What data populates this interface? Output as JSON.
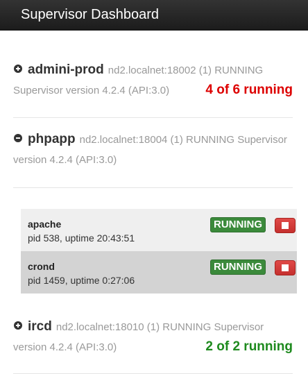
{
  "navbar": {
    "title": "Supervisor Dashboard"
  },
  "servers": [
    {
      "name": "admini-prod",
      "info": "nd2.localnet:18002 (1) RUNNING",
      "version": "Supervisor version 4.2.4 (API:3.0)",
      "count": "4 of 6 running",
      "count_color": "#dd0000",
      "expanded": false
    },
    {
      "name": "phpapp",
      "info": "nd2.localnet:18004 (1) RUNNING Supervisor",
      "version": "version 4.2.4 (API:3.0)",
      "expanded": true,
      "processes": [
        {
          "name": "apache",
          "detail": "pid 538, uptime 20:43:51",
          "state": "RUNNING"
        },
        {
          "name": "crond",
          "detail": "pid 1459, uptime 0:27:06",
          "state": "RUNNING"
        }
      ]
    },
    {
      "name": "ircd",
      "info": "nd2.localnet:18010 (1) RUNNING Supervisor",
      "version": "version 4.2.4 (API:3.0)",
      "count": "2 of 2 running",
      "count_color": "#1e8a1e",
      "expanded": false
    }
  ]
}
